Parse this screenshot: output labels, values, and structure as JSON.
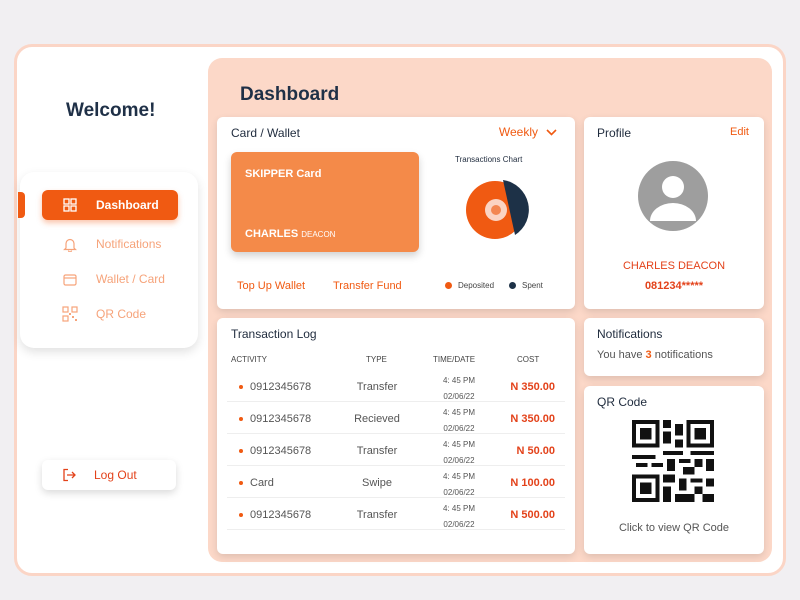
{
  "sidebar": {
    "welcome": "Welcome!",
    "items": [
      {
        "label": "Dashboard",
        "icon": "grid-icon",
        "active": true
      },
      {
        "label": "Notifications",
        "icon": "bell-icon",
        "active": false
      },
      {
        "label": "Wallet / Card",
        "icon": "wallet-icon",
        "active": false
      },
      {
        "label": "QR Code",
        "icon": "qr-icon",
        "active": false
      }
    ],
    "logout": "Log Out"
  },
  "dashboard": {
    "title": "Dashboard"
  },
  "card_wallet": {
    "title": "Card / Wallet",
    "period": "Weekly",
    "card_name": "SKIPPER Card",
    "card_holder_first": "CHARLES",
    "card_holder_last": "DEACON",
    "top_up": "Top Up Wallet",
    "transfer": "Transfer Fund",
    "chart_title": "Transactions Chart",
    "legend_deposited": "Deposited",
    "legend_spent": "Spent"
  },
  "profile": {
    "title": "Profile",
    "edit": "Edit",
    "name": "CHARLES DEACON",
    "phone": "081234*****"
  },
  "transaction_log": {
    "title": "Transaction Log",
    "columns": [
      "ACTIVITY",
      "TYPE",
      "TIME/DATE",
      "COST"
    ],
    "rows": [
      {
        "activity": "0912345678",
        "type": "Transfer",
        "time": "4: 45 PM",
        "date": "02/06/22",
        "cost": "N 350.00"
      },
      {
        "activity": "0912345678",
        "type": "Recieved",
        "time": "4: 45 PM",
        "date": "02/06/22",
        "cost": "N 350.00"
      },
      {
        "activity": "0912345678",
        "type": "Transfer",
        "time": "4: 45 PM",
        "date": "02/06/22",
        "cost": "N 50.00"
      },
      {
        "activity": "Card",
        "type": "Swipe",
        "time": "4: 45 PM",
        "date": "02/06/22",
        "cost": "N 100.00"
      },
      {
        "activity": "0912345678",
        "type": "Transfer",
        "time": "4: 45 PM",
        "date": "02/06/22",
        "cost": "N 500.00"
      }
    ]
  },
  "notifications": {
    "title": "Notifications",
    "prefix": "You have",
    "count": "3",
    "suffix": "notifications"
  },
  "qr": {
    "title": "QR Code",
    "hint": "Click to view QR Code"
  },
  "colors": {
    "accent": "#f05a12",
    "card": "#f48a49",
    "spent": "#1d3147",
    "main_bg": "#fcd8c8"
  }
}
